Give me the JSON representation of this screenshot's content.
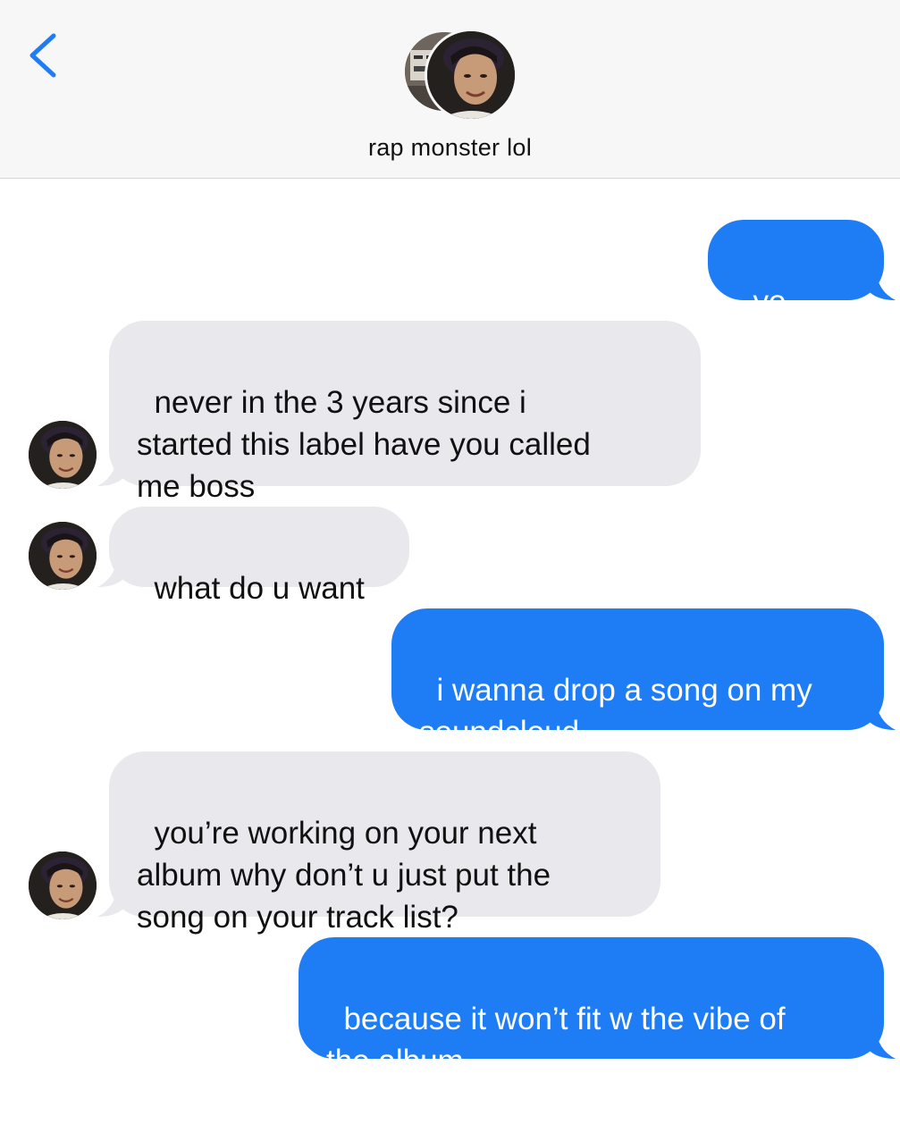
{
  "header": {
    "contact_name": "rap monster lol",
    "back_icon": "chevron-left-icon",
    "accent_color": "#1e7cf5"
  },
  "colors": {
    "sent_bubble": "#1e7cf5",
    "received_bubble": "#e8e8ed",
    "header_background": "#f7f7f7"
  },
  "messages": [
    {
      "direction": "sent",
      "text": "yo boss"
    },
    {
      "direction": "received",
      "text": "never in the 3 years since i\nstarted this label have you called\nme boss"
    },
    {
      "direction": "received",
      "text": "what do u want"
    },
    {
      "direction": "sent",
      "text": "i wanna drop a song on my\nsoundcloud"
    },
    {
      "direction": "received",
      "text": "you’re working on your next\nalbum why don’t u just put the\nsong on your track list?"
    },
    {
      "direction": "sent",
      "text": "because it won’t fit w the vibe of\nthe album"
    }
  ]
}
